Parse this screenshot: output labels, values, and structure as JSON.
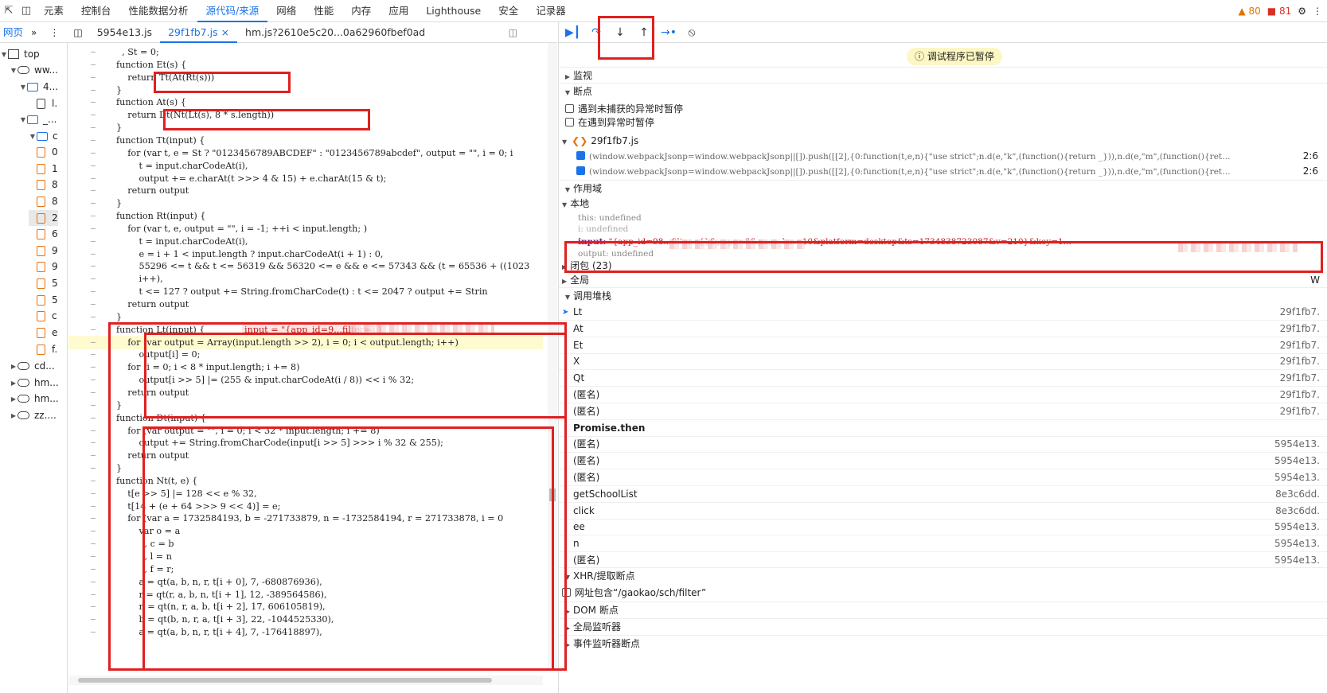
{
  "topbar": {
    "tabs": [
      "元素",
      "控制台",
      "性能数据分析",
      "源代码/来源",
      "网络",
      "性能",
      "内存",
      "应用",
      "Lighthouse",
      "安全",
      "记录器"
    ],
    "active_tab": "源代码/来源",
    "warnings": "80",
    "errors": "81"
  },
  "file_tabs": {
    "nav_label": "网页",
    "files": [
      "5954e13.js",
      "29f1fb7.js",
      "hm.js?2610e5c20...0a62960fbef0ad"
    ],
    "active": "29f1fb7.js"
  },
  "navigator": {
    "items": [
      {
        "label": "top",
        "icon": "frame-icon",
        "indent": 0
      },
      {
        "label": "ww...",
        "icon": "cloud-icon",
        "indent": 1
      },
      {
        "label": "4...",
        "icon": "folder-icon",
        "indent": 2
      },
      {
        "label": "l.",
        "icon": "file-icon-plain",
        "indent": 3
      },
      {
        "label": "_...",
        "icon": "folder-icon",
        "indent": 2
      },
      {
        "label": "c",
        "icon": "folder-icon",
        "indent": 3
      },
      {
        "label": "0",
        "icon": "file-icon",
        "indent": 3
      },
      {
        "label": "1",
        "icon": "file-icon",
        "indent": 3
      },
      {
        "label": "8",
        "icon": "file-icon",
        "indent": 3
      },
      {
        "label": "8",
        "icon": "file-icon",
        "indent": 3
      },
      {
        "label": "2",
        "icon": "file-icon",
        "indent": 3
      },
      {
        "label": "6",
        "icon": "file-icon",
        "indent": 3
      },
      {
        "label": "9",
        "icon": "file-icon",
        "indent": 3
      },
      {
        "label": "9",
        "icon": "file-icon",
        "indent": 3
      },
      {
        "label": "5",
        "icon": "file-icon",
        "indent": 3
      },
      {
        "label": "5",
        "icon": "file-icon",
        "indent": 3
      },
      {
        "label": "c",
        "icon": "file-icon",
        "indent": 3
      },
      {
        "label": "e",
        "icon": "file-icon",
        "indent": 3
      },
      {
        "label": "f.",
        "icon": "file-icon",
        "indent": 3
      },
      {
        "label": "cd...",
        "icon": "cloud-icon",
        "indent": 1
      },
      {
        "label": "hm...",
        "icon": "cloud-icon",
        "indent": 1
      },
      {
        "label": "hm...",
        "icon": "cloud-icon",
        "indent": 1
      },
      {
        "label": "zz....",
        "icon": "cloud-icon",
        "indent": 1
      }
    ]
  },
  "editor": {
    "lines": [
      "  , St = 0;",
      "function Et(s) {",
      "    return Tt(At(Rt(s)))",
      "}",
      "function At(s) {",
      "    return Dt(Nt(Lt(s), 8 * s.length))",
      "}",
      "function Tt(input) {",
      "    for (var t, e = St ? \"0123456789ABCDEF\" : \"0123456789abcdef\", output = \"\", i = 0; i",
      "        t = input.charCodeAt(i),",
      "        output += e.charAt(t >>> 4 & 15) + e.charAt(15 & t);",
      "    return output",
      "}",
      "function Rt(input) {",
      "    for (var t, e, output = \"\", i = -1; ++i < input.length; )",
      "        t = input.charCodeAt(i),",
      "        e = i + 1 < input.length ? input.charCodeAt(i + 1) : 0,",
      "        55296 <= t && t <= 56319 && 56320 <= e && e <= 57343 && (t = 65536 + ((1023",
      "        i++),",
      "        t <= 127 ? output += String.fromCharCode(t) : t <= 2047 ? output += Strin",
      "    return output",
      "}",
      "function Lt(input) {",
      "    for (var output = Array(input.length >> 2), i = 0; i < output.length; i++)",
      "        output[i] = 0;",
      "    for (i = 0; i < 8 * input.length; i += 8)",
      "        output[i >> 5] |= (255 & input.charCodeAt(i / 8)) << i % 32;",
      "    return output",
      "}",
      "function Dt(input) {",
      "    for (var output = \"\", i = 0; i < 32 * input.length; i += 8)",
      "        output += String.fromCharCode(input[i >> 5] >>> i % 32 & 255);",
      "    return output",
      "}",
      "function Nt(t, e) {",
      "    t[e >> 5] |= 128 << e % 32,",
      "    t[14 + (e + 64 >>> 9 << 4)] = e;",
      "    for (var a = 1732584193, b = -271733879, n = -1732584194, r = 271733878, i = 0",
      "        var o = a",
      "          , c = b",
      "          , l = n",
      "          , f = r;",
      "        a = qt(a, b, n, r, t[i + 0], 7, -680876936),",
      "        r = qt(r, a, b, n, t[i + 1], 12, -389564586),",
      "        n = qt(n, r, a, b, t[i + 2], 17, 606105819),",
      "        b = qt(b, n, r, a, t[i + 3], 22, -1044525330),",
      "        a = qt(a, b, n, r, t[i + 4], 7, -176418897),"
    ],
    "inline_value": "input = \"{app_id=9...filter={}",
    "gutter_mark": "–"
  },
  "debugger": {
    "toolbar_icons": [
      "resume-icon",
      "step-over-icon",
      "step-into-icon",
      "step-out-icon",
      "step-icon",
      "deactivate-breakpoints-icon"
    ],
    "paused_label": "调试程序已暂停",
    "sections": {
      "watch": "监视",
      "breakpoints": "断点",
      "scope": "作用域",
      "call_stack": "调用堆栈",
      "xhr": "XHR/提取断点",
      "dom": "DOM 断点",
      "global_listeners": "全局监听器",
      "event_listeners": "事件监听器断点"
    },
    "pause_uncaught": "遇到未捕获的异常时暂停",
    "pause_caught": "在遇到异常时暂停",
    "bp_file": "29f1fb7.js",
    "bp_lines": [
      {
        "code": "(window.webpackJsonp=window.webpackJsonp||[]).push([[2],{0:function(t,e,n){\"use strict\";n.d(e,\"k\",(function(){return _})),n.d(e,\"m\",(function(){ret…",
        "loc": "2:6"
      },
      {
        "code": "(window.webpackJsonp=window.webpackJsonp||[]).push([[2],{0:function(t,e,n){\"use strict\";n.d(e,\"k\",(function(){return _})),n.d(e,\"m\",(function(){ret…",
        "loc": "2:6"
      }
    ],
    "scope": {
      "local_label": "本地",
      "this_line": "this: undefined",
      "i_line": "i: undefined",
      "input_key": "input:",
      "input_value": "\"{app_id=98...filter={}&page=6&page_len=10&platform=desktop&ts=1734838723087&v=210}&key=1...",
      "output_line": "output: undefined",
      "closure": "闭包 (23)",
      "global": "全局",
      "global_value": "W"
    },
    "call_stack": [
      {
        "fn": "Lt",
        "loc": "29f1fb7.",
        "async": false
      },
      {
        "fn": "At",
        "loc": "29f1fb7.",
        "async": false
      },
      {
        "fn": "Et",
        "loc": "29f1fb7.",
        "async": false
      },
      {
        "fn": "X",
        "loc": "29f1fb7.",
        "async": false
      },
      {
        "fn": "Qt",
        "loc": "29f1fb7.",
        "async": false
      },
      {
        "fn": "(匿名)",
        "loc": "29f1fb7.",
        "async": false
      },
      {
        "fn": "(匿名)",
        "loc": "29f1fb7.",
        "async": false
      },
      {
        "fn": "Promise.then",
        "loc": "",
        "async": true
      },
      {
        "fn": "(匿名)",
        "loc": "5954e13.",
        "async": false
      },
      {
        "fn": "(匿名)",
        "loc": "5954e13.",
        "async": false
      },
      {
        "fn": "(匿名)",
        "loc": "5954e13.",
        "async": false
      },
      {
        "fn": "getSchoolList",
        "loc": "8e3c6dd.",
        "async": false
      },
      {
        "fn": "click",
        "loc": "8e3c6dd.",
        "async": false
      },
      {
        "fn": "ee",
        "loc": "5954e13.",
        "async": false
      },
      {
        "fn": "n",
        "loc": "5954e13.",
        "async": false
      },
      {
        "fn": "(匿名)",
        "loc": "5954e13.",
        "async": false
      }
    ],
    "xhr_bp": "网址包含“/gaokao/sch/filter”"
  }
}
